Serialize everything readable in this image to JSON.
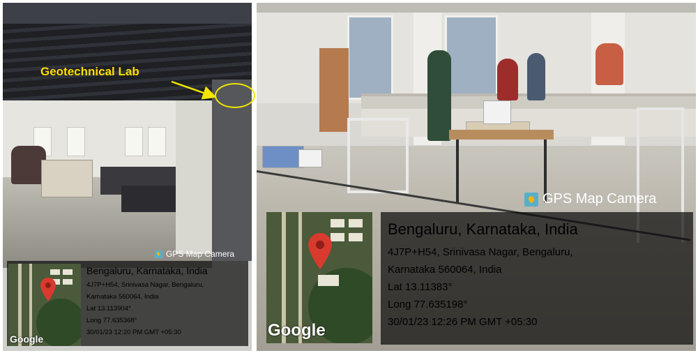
{
  "annotation": {
    "label": "Geotechnical Lab",
    "color": "#ffde00"
  },
  "left_photo": {
    "gps_title": "GPS Map Camera",
    "city": "Bengaluru, Karnataka, India",
    "address_line1": "4J7P+H54, Srinivasa Nagar, Bengaluru,",
    "address_line2": "Karnataka 560064, India",
    "lat": "Lat 13.113904°",
    "long": "Long 77.635368°",
    "datetime": "30/01/23 12:20 PM GMT +05:30",
    "map_brand": "Google"
  },
  "right_photo": {
    "gps_title": "GPS Map Camera",
    "city": "Bengaluru, Karnataka, India",
    "address_line1": "4J7P+H54, Srinivasa Nagar, Bengaluru,",
    "address_line2": "Karnataka 560064, India",
    "lat": "Lat 13.11383°",
    "long": "Long 77.635198°",
    "datetime": "30/01/23 12:26 PM GMT +05:30",
    "map_brand": "Google"
  },
  "icons": {
    "gps_app": "map-camera-icon",
    "pin": "location-pin-icon"
  },
  "colors": {
    "pin": "#d83a2e",
    "overlay": "#0c0c0c"
  }
}
